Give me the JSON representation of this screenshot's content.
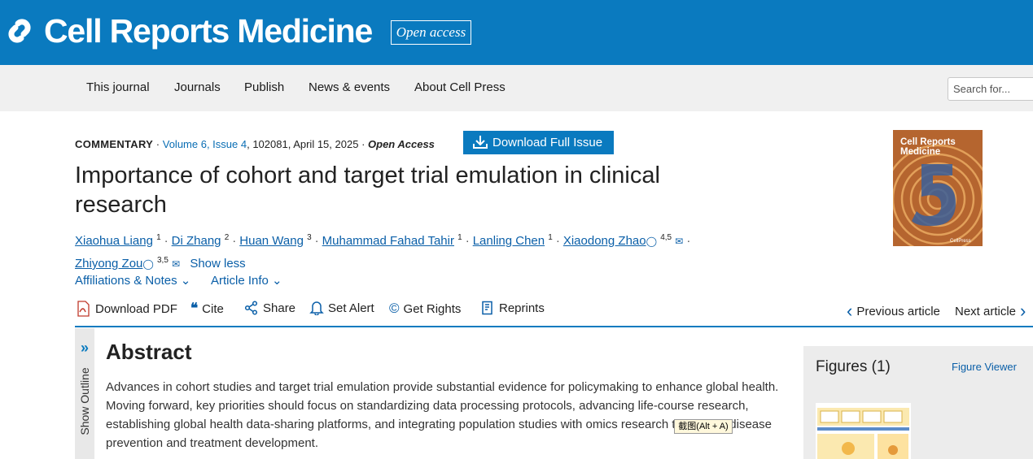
{
  "header": {
    "brand": "Cell Reports Medicine",
    "badge": "Open access",
    "logo_icon": "chain-link-icon",
    "bg_color": "#0a7abf"
  },
  "nav": {
    "items": [
      "This journal",
      "Journals",
      "Publish",
      "News & events",
      "About Cell Press"
    ],
    "search_placeholder": "Search for..."
  },
  "article": {
    "type": "COMMENTARY",
    "volume_issue": "Volume 6, Issue 4",
    "details": ", 102081, April 15, 2025",
    "access": "Open Access",
    "download_issue": "Download Full Issue",
    "title": "Importance of cohort and target trial emulation in clinical research",
    "authors": [
      {
        "name": "Xiaohua Liang",
        "sup": "1"
      },
      {
        "name": "Di Zhang",
        "sup": "2"
      },
      {
        "name": "Huan Wang",
        "sup": "3"
      },
      {
        "name": "Muhammad Fahad Tahir",
        "sup": "1"
      },
      {
        "name": "Lanling Chen",
        "sup": "1"
      },
      {
        "name": "Xiaodong Zhao",
        "sup": "4,5"
      },
      {
        "name": "Zhiyong Zou",
        "sup": "3,5"
      }
    ],
    "show_less": "Show less",
    "affiliations": "Affiliations & Notes",
    "article_info": "Article Info"
  },
  "toolbar": {
    "download_pdf": "Download PDF",
    "cite": "Cite",
    "share": "Share",
    "set_alert": "Set Alert",
    "get_rights": "Get Rights",
    "reprints": "Reprints",
    "prev": "Previous article",
    "next": "Next article"
  },
  "outline": {
    "label": "Show Outline"
  },
  "abstract": {
    "heading": "Abstract",
    "text": "Advances in cohort studies and target trial emulation provide substantial evidence for policymaking to enhance global health. Moving forward, key priorities should focus on standardizing data processing protocols, advancing life-course research, establishing global health data-sharing platforms, and integrating population studies with omics research to support disease prevention and treatment development."
  },
  "tooltip": "截图(Alt + A)",
  "cover": {
    "title_line1": "Cell Reports",
    "title_line2": "Medicine",
    "issue_number": "5",
    "publisher": "CellPress"
  },
  "figures": {
    "heading": "Figures (1)",
    "viewer": "Figure Viewer"
  }
}
